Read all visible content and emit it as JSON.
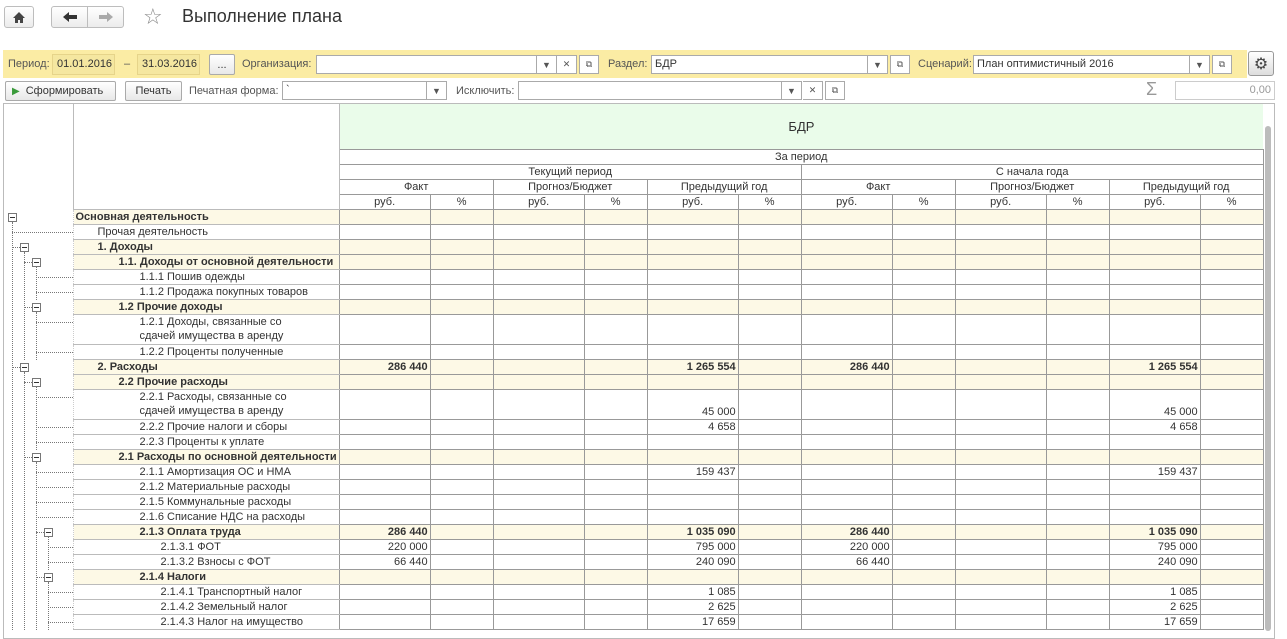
{
  "window": {
    "title": "Выполнение плана"
  },
  "filter": {
    "period_label": "Период:",
    "date_from": "01.01.2016",
    "dash": "–",
    "date_to": "31.03.2016",
    "period_btn": "...",
    "org_label": "Организация:",
    "org_value": "",
    "section_label": "Раздел:",
    "section_value": "БДР",
    "scenario_label": "Сценарий:",
    "scenario_value": "План оптимистичный 2016"
  },
  "toolbar": {
    "generate": "Сформировать",
    "print": "Печать",
    "print_form_label": "Печатная форма:",
    "print_form_value": "`",
    "exclude_label": "Исключить:",
    "exclude_value": "",
    "sum_value": "0,00"
  },
  "report": {
    "title": "БДР",
    "period": "За период",
    "current": "Текущий период",
    "ytd": "С начала года",
    "fact": "Факт",
    "forecast": "Прогноз/Бюджет",
    "prev_year": "Предыдущий год",
    "rub": "руб.",
    "pct": "%",
    "rows": [
      {
        "label": "Основная деятельность",
        "level": 0,
        "bold": true,
        "group": true,
        "v": [
          "",
          "",
          "",
          "",
          "",
          "",
          "",
          "",
          "",
          "",
          "",
          ""
        ]
      },
      {
        "label": "Прочая деятельность",
        "level": 1,
        "bold": false,
        "group": false,
        "v": [
          "",
          "",
          "",
          "",
          "",
          "",
          "",
          "",
          "",
          "",
          "",
          ""
        ]
      },
      {
        "label": "1. Доходы",
        "level": 1,
        "bold": true,
        "group": true,
        "v": [
          "",
          "",
          "",
          "",
          "",
          "",
          "",
          "",
          "",
          "",
          "",
          ""
        ]
      },
      {
        "label": "1.1. Доходы от основной деятельности",
        "level": 2,
        "bold": true,
        "group": true,
        "v": [
          "",
          "",
          "",
          "",
          "",
          "",
          "",
          "",
          "",
          "",
          "",
          ""
        ]
      },
      {
        "label": "1.1.1 Пошив одежды",
        "level": 3,
        "bold": false,
        "group": false,
        "v": [
          "",
          "",
          "",
          "",
          "",
          "",
          "",
          "",
          "",
          "",
          "",
          ""
        ]
      },
      {
        "label": "1.1.2 Продажа покупных товаров",
        "level": 3,
        "bold": false,
        "group": false,
        "v": [
          "",
          "",
          "",
          "",
          "",
          "",
          "",
          "",
          "",
          "",
          "",
          ""
        ]
      },
      {
        "label": "1.2 Прочие доходы",
        "level": 2,
        "bold": true,
        "group": true,
        "v": [
          "",
          "",
          "",
          "",
          "",
          "",
          "",
          "",
          "",
          "",
          "",
          ""
        ]
      },
      {
        "label": "1.2.1 Доходы, связанные со",
        "label2": "сдачей имущества в аренду",
        "level": 3,
        "bold": false,
        "group": false,
        "v": [
          "",
          "",
          "",
          "",
          "",
          "",
          "",
          "",
          "",
          "",
          "",
          ""
        ]
      },
      {
        "label": "1.2.2 Проценты полученные",
        "level": 3,
        "bold": false,
        "group": false,
        "v": [
          "",
          "",
          "",
          "",
          "",
          "",
          "",
          "",
          "",
          "",
          "",
          ""
        ]
      },
      {
        "label": "2. Расходы",
        "level": 1,
        "bold": true,
        "group": true,
        "v": [
          "286 440",
          "",
          "",
          "",
          "1 265 554",
          "",
          "286 440",
          "",
          "",
          "",
          "1 265 554",
          ""
        ]
      },
      {
        "label": "2.2 Прочие расходы",
        "level": 2,
        "bold": true,
        "group": true,
        "v": [
          "",
          "",
          "",
          "",
          "",
          "",
          "",
          "",
          "",
          "",
          "",
          ""
        ]
      },
      {
        "label": "2.2.1 Расходы, связанные со",
        "label2": "сдачей имущества в аренду",
        "level": 3,
        "bold": false,
        "group": false,
        "v": [
          "",
          "",
          "",
          "",
          "45 000",
          "",
          "",
          "",
          "",
          "",
          "45 000",
          ""
        ]
      },
      {
        "label": "2.2.2 Прочие налоги и сборы",
        "level": 3,
        "bold": false,
        "group": false,
        "v": [
          "",
          "",
          "",
          "",
          "4 658",
          "",
          "",
          "",
          "",
          "",
          "4 658",
          ""
        ]
      },
      {
        "label": "2.2.3 Проценты к уплате",
        "level": 3,
        "bold": false,
        "group": false,
        "v": [
          "",
          "",
          "",
          "",
          "",
          "",
          "",
          "",
          "",
          "",
          "",
          ""
        ]
      },
      {
        "label": "2.1 Расходы по основной деятельности",
        "level": 2,
        "bold": true,
        "group": true,
        "v": [
          "",
          "",
          "",
          "",
          "",
          "",
          "",
          "",
          "",
          "",
          "",
          ""
        ]
      },
      {
        "label": "2.1.1 Амортизация ОС и НМА",
        "level": 3,
        "bold": false,
        "group": false,
        "v": [
          "",
          "",
          "",
          "",
          "159 437",
          "",
          "",
          "",
          "",
          "",
          "159 437",
          ""
        ]
      },
      {
        "label": "2.1.2 Материальные расходы",
        "level": 3,
        "bold": false,
        "group": false,
        "v": [
          "",
          "",
          "",
          "",
          "",
          "",
          "",
          "",
          "",
          "",
          "",
          ""
        ]
      },
      {
        "label": "2.1.5 Коммунальные расходы",
        "level": 3,
        "bold": false,
        "group": false,
        "v": [
          "",
          "",
          "",
          "",
          "",
          "",
          "",
          "",
          "",
          "",
          "",
          ""
        ]
      },
      {
        "label": "2.1.6 Списание НДС на расходы",
        "level": 3,
        "bold": false,
        "group": false,
        "v": [
          "",
          "",
          "",
          "",
          "",
          "",
          "",
          "",
          "",
          "",
          "",
          ""
        ]
      },
      {
        "label": "2.1.3 Оплата труда",
        "level": 3,
        "bold": true,
        "group": true,
        "v": [
          "286 440",
          "",
          "",
          "",
          "1 035 090",
          "",
          "286 440",
          "",
          "",
          "",
          "1 035 090",
          ""
        ]
      },
      {
        "label": "2.1.3.1 ФОТ",
        "level": 4,
        "bold": false,
        "group": false,
        "v": [
          "220 000",
          "",
          "",
          "",
          "795 000",
          "",
          "220 000",
          "",
          "",
          "",
          "795 000",
          ""
        ]
      },
      {
        "label": "2.1.3.2 Взносы с ФОТ",
        "level": 4,
        "bold": false,
        "group": false,
        "v": [
          "66 440",
          "",
          "",
          "",
          "240 090",
          "",
          "66 440",
          "",
          "",
          "",
          "240 090",
          ""
        ]
      },
      {
        "label": "2.1.4 Налоги",
        "level": 3,
        "bold": true,
        "group": true,
        "v": [
          "",
          "",
          "",
          "",
          "",
          "",
          "",
          "",
          "",
          "",
          "",
          ""
        ]
      },
      {
        "label": "2.1.4.1 Транспортный налог",
        "level": 4,
        "bold": false,
        "group": false,
        "v": [
          "",
          "",
          "",
          "",
          "1 085",
          "",
          "",
          "",
          "",
          "",
          "1 085",
          ""
        ]
      },
      {
        "label": "2.1.4.2 Земельный налог",
        "level": 4,
        "bold": false,
        "group": false,
        "v": [
          "",
          "",
          "",
          "",
          "2 625",
          "",
          "",
          "",
          "",
          "",
          "2 625",
          ""
        ]
      },
      {
        "label": "2.1.4.3 Налог на имущество",
        "level": 4,
        "bold": false,
        "group": false,
        "v": [
          "",
          "",
          "",
          "",
          "17 659",
          "",
          "",
          "",
          "",
          "",
          "17 659",
          ""
        ]
      }
    ]
  }
}
